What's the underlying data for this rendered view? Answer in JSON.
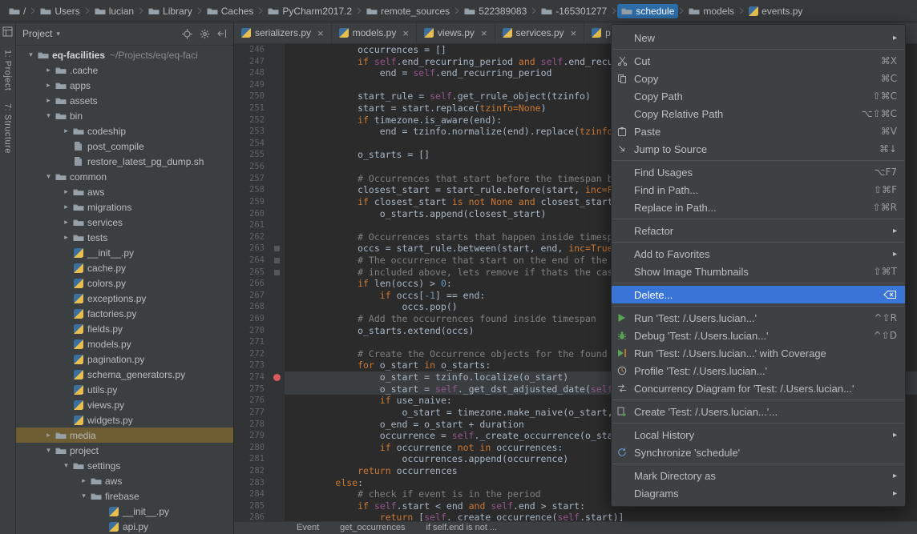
{
  "colors": {
    "panel_bg": "#3c3f41",
    "editor_bg": "#2b2b2b",
    "gutter_bg": "#313335",
    "menu_selection": "#3875d6",
    "breadcrumb_selection": "#2d6da8",
    "tree_selection": "#6f5e33",
    "keyword": "#cc7832",
    "self_keyword": "#94558d",
    "comment": "#808080",
    "number": "#6897bb",
    "code_text": "#a9b7c6",
    "breakpoint": "#db5860"
  },
  "breadcrumb_bar": {
    "items": [
      {
        "label": "/",
        "icon": "folder"
      },
      {
        "label": "Users",
        "icon": "folder"
      },
      {
        "label": "lucian",
        "icon": "folder"
      },
      {
        "label": "Library",
        "icon": "folder"
      },
      {
        "label": "Caches",
        "icon": "folder"
      },
      {
        "label": "PyCharm2017.2",
        "icon": "folder"
      },
      {
        "label": "remote_sources",
        "icon": "folder"
      },
      {
        "label": "522389083",
        "icon": "folder"
      },
      {
        "label": "-165301277",
        "icon": "folder"
      },
      {
        "label": "schedule",
        "icon": "folder",
        "selected": true
      },
      {
        "label": "models",
        "icon": "folder"
      },
      {
        "label": "events.py",
        "icon": "py"
      }
    ]
  },
  "tool_window_bar": {
    "project_label": "1: Project",
    "structure_label": "7: Structure"
  },
  "project_panel": {
    "title": "Project",
    "tree": [
      {
        "label": "eq-facilities",
        "hint": "~/Projects/eq/eq-faci",
        "level": 0,
        "arrow": "v",
        "icon": "folder",
        "bold": true
      },
      {
        "label": ".cache",
        "level": 1,
        "arrow": ">",
        "icon": "folder"
      },
      {
        "label": "apps",
        "level": 1,
        "arrow": ">",
        "icon": "folder"
      },
      {
        "label": "assets",
        "level": 1,
        "arrow": ">",
        "icon": "folder"
      },
      {
        "label": "bin",
        "level": 1,
        "arrow": "v",
        "icon": "folder"
      },
      {
        "label": "codeship",
        "level": 2,
        "arrow": ">",
        "icon": "folder"
      },
      {
        "label": "post_compile",
        "level": 2,
        "icon": "file"
      },
      {
        "label": "restore_latest_pg_dump.sh",
        "level": 2,
        "icon": "file"
      },
      {
        "label": "common",
        "level": 1,
        "arrow": "v",
        "icon": "folder"
      },
      {
        "label": "aws",
        "level": 2,
        "arrow": ">",
        "icon": "folder"
      },
      {
        "label": "migrations",
        "level": 2,
        "arrow": ">",
        "icon": "folder"
      },
      {
        "label": "services",
        "level": 2,
        "arrow": ">",
        "icon": "folder"
      },
      {
        "label": "tests",
        "level": 2,
        "arrow": ">",
        "icon": "folder"
      },
      {
        "label": "__init__.py",
        "level": 2,
        "icon": "py"
      },
      {
        "label": "cache.py",
        "level": 2,
        "icon": "py"
      },
      {
        "label": "colors.py",
        "level": 2,
        "icon": "py"
      },
      {
        "label": "exceptions.py",
        "level": 2,
        "icon": "py"
      },
      {
        "label": "factories.py",
        "level": 2,
        "icon": "py"
      },
      {
        "label": "fields.py",
        "level": 2,
        "icon": "py"
      },
      {
        "label": "models.py",
        "level": 2,
        "icon": "py"
      },
      {
        "label": "pagination.py",
        "level": 2,
        "icon": "py"
      },
      {
        "label": "schema_generators.py",
        "level": 2,
        "icon": "py"
      },
      {
        "label": "utils.py",
        "level": 2,
        "icon": "py"
      },
      {
        "label": "views.py",
        "level": 2,
        "icon": "py"
      },
      {
        "label": "widgets.py",
        "level": 2,
        "icon": "py"
      },
      {
        "label": "media",
        "level": 1,
        "arrow": ">",
        "icon": "folder",
        "selected": true
      },
      {
        "label": "project",
        "level": 1,
        "arrow": "v",
        "icon": "folder"
      },
      {
        "label": "settings",
        "level": 2,
        "arrow": "v",
        "icon": "folder"
      },
      {
        "label": "aws",
        "level": 3,
        "arrow": ">",
        "icon": "folder"
      },
      {
        "label": "firebase",
        "level": 3,
        "arrow": "v",
        "icon": "folder"
      },
      {
        "label": "__init__.py",
        "level": 4,
        "icon": "py"
      },
      {
        "label": "api.py",
        "level": 4,
        "icon": "py"
      }
    ]
  },
  "editor": {
    "tabs": [
      {
        "label": "serializers.py"
      },
      {
        "label": "models.py"
      },
      {
        "label": "views.py"
      },
      {
        "label": "services.py"
      },
      {
        "label": "per"
      }
    ],
    "gutter_marks": [
      263,
      264,
      265
    ],
    "bottom_breadcrumbs": [
      "Event",
      "get_occurrences",
      "if self.end is not ..."
    ],
    "lines": [
      {
        "n": 246,
        "t": [
          [
            "p",
            "            occurrences = []"
          ]
        ]
      },
      {
        "n": 247,
        "t": [
          [
            "p",
            "            "
          ],
          [
            "k",
            "if"
          ],
          [
            "p",
            " "
          ],
          [
            "s",
            "self"
          ],
          [
            "p",
            ".end_recurring_period "
          ],
          [
            "k",
            "and"
          ],
          [
            "p",
            " "
          ],
          [
            "s",
            "self"
          ],
          [
            "p",
            ".end_recu"
          ]
        ]
      },
      {
        "n": 248,
        "t": [
          [
            "p",
            "                end = "
          ],
          [
            "s",
            "self"
          ],
          [
            "p",
            ".end_recurring_period"
          ]
        ]
      },
      {
        "n": 249,
        "t": []
      },
      {
        "n": 250,
        "t": [
          [
            "p",
            "            start_rule = "
          ],
          [
            "s",
            "self"
          ],
          [
            "p",
            ".get_rrule_object(tzinfo)"
          ]
        ]
      },
      {
        "n": 251,
        "t": [
          [
            "p",
            "            start = start.replace("
          ],
          [
            "k",
            "tzinfo=None"
          ],
          [
            "p",
            ")"
          ]
        ]
      },
      {
        "n": 252,
        "t": [
          [
            "p",
            "            "
          ],
          [
            "k",
            "if"
          ],
          [
            "p",
            " timezone.is_aware(end):"
          ]
        ]
      },
      {
        "n": 253,
        "t": [
          [
            "p",
            "                end = tzinfo.normalize(end).replace("
          ],
          [
            "k",
            "tzinfo"
          ]
        ]
      },
      {
        "n": 254,
        "t": []
      },
      {
        "n": 255,
        "t": [
          [
            "p",
            "            o_starts = []"
          ]
        ]
      },
      {
        "n": 256,
        "t": []
      },
      {
        "n": 257,
        "t": [
          [
            "c",
            "            # Occurrences that start before the timespan b"
          ]
        ]
      },
      {
        "n": 258,
        "t": [
          [
            "p",
            "            closest_start = start_rule.before(start, "
          ],
          [
            "k",
            "inc=F"
          ]
        ]
      },
      {
        "n": 259,
        "t": [
          [
            "p",
            "            "
          ],
          [
            "k",
            "if"
          ],
          [
            "p",
            " closest_start "
          ],
          [
            "k",
            "is not None"
          ],
          [
            "p",
            " "
          ],
          [
            "k",
            "and"
          ],
          [
            "p",
            " closest_start"
          ]
        ]
      },
      {
        "n": 260,
        "t": [
          [
            "p",
            "                o_starts.append(closest_start)"
          ]
        ]
      },
      {
        "n": 261,
        "t": []
      },
      {
        "n": 262,
        "t": [
          [
            "c",
            "            # Occurrences starts that happen inside timesp"
          ]
        ]
      },
      {
        "n": 263,
        "t": [
          [
            "p",
            "            occs = start_rule.between(start, end, "
          ],
          [
            "k",
            "inc=True"
          ]
        ]
      },
      {
        "n": 264,
        "t": [
          [
            "c",
            "            # The occurrence that start on the end of the "
          ]
        ]
      },
      {
        "n": 265,
        "t": [
          [
            "c",
            "            # included above, lets remove if thats the cas"
          ]
        ]
      },
      {
        "n": 266,
        "t": [
          [
            "p",
            "            "
          ],
          [
            "k",
            "if"
          ],
          [
            "p",
            " len(occs) > "
          ],
          [
            "nm",
            "0"
          ],
          [
            "p",
            ":"
          ]
        ]
      },
      {
        "n": 267,
        "t": [
          [
            "p",
            "                "
          ],
          [
            "k",
            "if"
          ],
          [
            "p",
            " occs["
          ],
          [
            "nm",
            "-1"
          ],
          [
            "p",
            "] == end:"
          ]
        ]
      },
      {
        "n": 268,
        "t": [
          [
            "p",
            "                    occs.pop()"
          ]
        ]
      },
      {
        "n": 269,
        "t": [
          [
            "c",
            "            # Add the occurrences found inside timespan"
          ]
        ]
      },
      {
        "n": 270,
        "t": [
          [
            "p",
            "            o_starts.extend(occs)"
          ]
        ]
      },
      {
        "n": 271,
        "t": []
      },
      {
        "n": 272,
        "t": [
          [
            "c",
            "            # Create the Occurrence objects for the found "
          ]
        ]
      },
      {
        "n": 273,
        "t": [
          [
            "p",
            "            "
          ],
          [
            "k",
            "for"
          ],
          [
            "p",
            " o_start "
          ],
          [
            "k",
            "in"
          ],
          [
            "p",
            " o_starts:"
          ]
        ]
      },
      {
        "n": 274,
        "bp": true,
        "hl": true,
        "t": [
          [
            "p",
            "                o_start = tzinfo.localize(o_start)"
          ]
        ]
      },
      {
        "n": 275,
        "hl": true,
        "t": [
          [
            "p",
            "                o_start = "
          ],
          [
            "s",
            "self"
          ],
          [
            "p",
            "._get_dst_adjusted_date("
          ],
          [
            "s",
            "self"
          ]
        ]
      },
      {
        "n": 276,
        "t": [
          [
            "p",
            "                "
          ],
          [
            "k",
            "if"
          ],
          [
            "p",
            " use_naive:"
          ]
        ]
      },
      {
        "n": 277,
        "t": [
          [
            "p",
            "                    o_start = timezone.make_naive(o_start, "
          ]
        ]
      },
      {
        "n": 278,
        "t": [
          [
            "p",
            "                o_end = o_start + duration"
          ]
        ]
      },
      {
        "n": 279,
        "t": [
          [
            "p",
            "                occurrence = "
          ],
          [
            "s",
            "self"
          ],
          [
            "p",
            "._create_occurrence(o_sta"
          ]
        ]
      },
      {
        "n": 280,
        "t": [
          [
            "p",
            "                "
          ],
          [
            "k",
            "if"
          ],
          [
            "p",
            " occurrence "
          ],
          [
            "k",
            "not in"
          ],
          [
            "p",
            " occurrences:"
          ]
        ]
      },
      {
        "n": 281,
        "t": [
          [
            "p",
            "                    occurrences.append(occurrence)"
          ]
        ]
      },
      {
        "n": 282,
        "t": [
          [
            "p",
            "            "
          ],
          [
            "k",
            "return"
          ],
          [
            "p",
            " occurrences"
          ]
        ]
      },
      {
        "n": 283,
        "t": [
          [
            "p",
            "        "
          ],
          [
            "k",
            "else"
          ],
          [
            "p",
            ":"
          ]
        ]
      },
      {
        "n": 284,
        "t": [
          [
            "c",
            "            # check if event is in the period"
          ]
        ]
      },
      {
        "n": 285,
        "t": [
          [
            "p",
            "            "
          ],
          [
            "k",
            "if"
          ],
          [
            "p",
            " "
          ],
          [
            "s",
            "self"
          ],
          [
            "p",
            ".start < end "
          ],
          [
            "k",
            "and"
          ],
          [
            "p",
            " "
          ],
          [
            "s",
            "self"
          ],
          [
            "p",
            ".end > start:"
          ]
        ]
      },
      {
        "n": 286,
        "t": [
          [
            "p",
            "                "
          ],
          [
            "k",
            "return"
          ],
          [
            "p",
            " ["
          ],
          [
            "s",
            "self"
          ],
          [
            "p",
            "._create_occurrence("
          ],
          [
            "s",
            "self"
          ],
          [
            "p",
            ".start)]"
          ]
        ]
      }
    ]
  },
  "context_menu": {
    "items": [
      {
        "label": "New",
        "submenu": true
      },
      {
        "type": "sep"
      },
      {
        "label": "Cut",
        "icon": "cut",
        "shortcut": "⌘X"
      },
      {
        "label": "Copy",
        "icon": "copy",
        "shortcut": "⌘C"
      },
      {
        "label": "Copy Path",
        "shortcut": "⇧⌘C"
      },
      {
        "label": "Copy Relative Path",
        "shortcut": "⌥⇧⌘C"
      },
      {
        "label": "Paste",
        "icon": "paste",
        "shortcut": "⌘V"
      },
      {
        "label": "Jump to Source",
        "icon": "jump",
        "shortcut": "⌘↓"
      },
      {
        "type": "sep"
      },
      {
        "label": "Find Usages",
        "shortcut": "⌥F7"
      },
      {
        "label": "Find in Path...",
        "shortcut": "⇧⌘F"
      },
      {
        "label": "Replace in Path...",
        "shortcut": "⇧⌘R"
      },
      {
        "type": "sep"
      },
      {
        "label": "Refactor",
        "submenu": true
      },
      {
        "type": "sep"
      },
      {
        "label": "Add to Favorites",
        "submenu": true
      },
      {
        "label": "Show Image Thumbnails",
        "shortcut": "⇧⌘T"
      },
      {
        "type": "sep"
      },
      {
        "label": "Delete...",
        "selected": true,
        "shortcut_icon": "backspace"
      },
      {
        "type": "sep"
      },
      {
        "label": "Run 'Test: /.Users.lucian...'",
        "icon": "run",
        "shortcut": "^⇧R"
      },
      {
        "label": "Debug 'Test: /.Users.lucian...'",
        "icon": "debug",
        "shortcut": "^⇧D"
      },
      {
        "label": "Run 'Test: /.Users.lucian...' with Coverage",
        "icon": "runcov"
      },
      {
        "label": "Profile 'Test: /.Users.lucian...'",
        "icon": "profile"
      },
      {
        "label": "Concurrency Diagram for  'Test: /.Users.lucian...'",
        "icon": "concurrency"
      },
      {
        "type": "sep"
      },
      {
        "label": "Create 'Test: /.Users.lucian...'...",
        "icon": "create"
      },
      {
        "type": "sep"
      },
      {
        "label": "Local History",
        "submenu": true
      },
      {
        "label": "Synchronize 'schedule'",
        "icon": "sync"
      },
      {
        "type": "sep"
      },
      {
        "label": "Mark Directory as",
        "submenu": true
      },
      {
        "label": "Diagrams",
        "submenu": true
      }
    ]
  }
}
